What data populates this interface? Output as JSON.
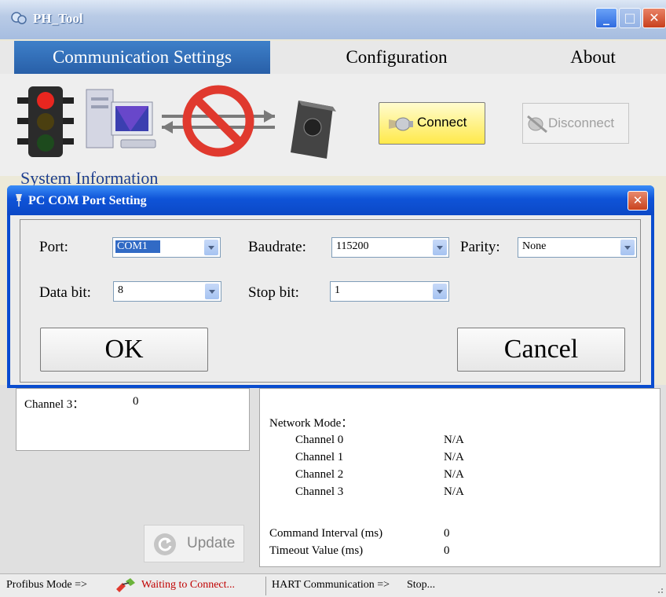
{
  "window": {
    "title": "PH_Tool"
  },
  "menu": {
    "items": [
      "Communication Settings",
      "Configuration",
      "About"
    ]
  },
  "toolbar": {
    "connect_label": "Connect",
    "disconnect_label": "Disconnect"
  },
  "system_info_heading": "System Information",
  "dialog": {
    "title": "PC COM Port Setting",
    "port_label": "Port:",
    "port_value": "COM1",
    "baud_label": "Baudrate:",
    "baud_value": "115200",
    "parity_label": "Parity:",
    "parity_value": "None",
    "databit_label": "Data bit:",
    "databit_value": "8",
    "stopbit_label": "Stop bit:",
    "stopbit_value": "1",
    "ok_label": "OK",
    "cancel_label": "Cancel"
  },
  "left_panel": {
    "channel3_label": "Channel 3：",
    "channel3_value": "0",
    "update_label": "Update"
  },
  "right_panel": {
    "network_mode_label": "Network Mode：",
    "channels": [
      {
        "name": "Channel 0",
        "value": "N/A"
      },
      {
        "name": "Channel 1",
        "value": "N/A"
      },
      {
        "name": "Channel 2",
        "value": "N/A"
      },
      {
        "name": "Channel 3",
        "value": "N/A"
      }
    ],
    "command_interval_label": "Command Interval (ms)",
    "command_interval_value": "0",
    "timeout_label": "Timeout Value (ms)",
    "timeout_value": "0"
  },
  "status": {
    "profibus_label": "Profibus Mode =>",
    "profibus_state": "Waiting to Connect...",
    "hart_label": "HART Communication =>",
    "hart_state": "Stop..."
  },
  "colors": {
    "accent": "#285fa8",
    "dialog_title": "#0f54d8",
    "status_warn": "#c00000",
    "heading": "#1e3f91"
  }
}
